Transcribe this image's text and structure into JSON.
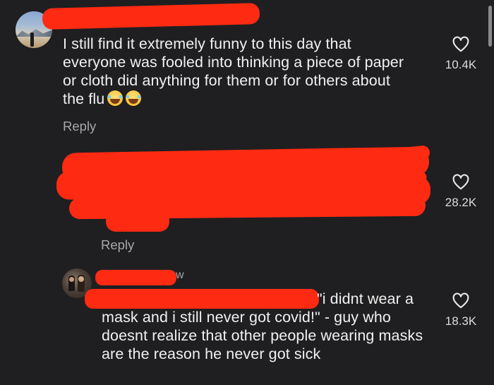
{
  "comments": [
    {
      "text": "I still find it extremely funny to this day that everyone was fooled into thinking a piece of paper or cloth did anything for them or for others about the flu",
      "emojis": [
        "laughing-crying-emoji",
        "laughing-crying-emoji"
      ],
      "reply_label": "Reply",
      "likes": "10.4K"
    },
    {
      "reply_label": "Reply",
      "likes": "28.2K"
    },
    {
      "timestamp_fragment": "w",
      "text_first": "\"i didnt wear a",
      "text_rest": "mask and i still never got covid!\" - guy who doesnt realize that other people wearing masks are the reason he never got sick",
      "likes": "18.3K"
    }
  ],
  "colors": {
    "background": "#1f1f21",
    "redaction": "#ff2a12",
    "text": "#f1f1f1",
    "muted": "#a8a8a8"
  },
  "icons": [
    "heart-icon"
  ]
}
